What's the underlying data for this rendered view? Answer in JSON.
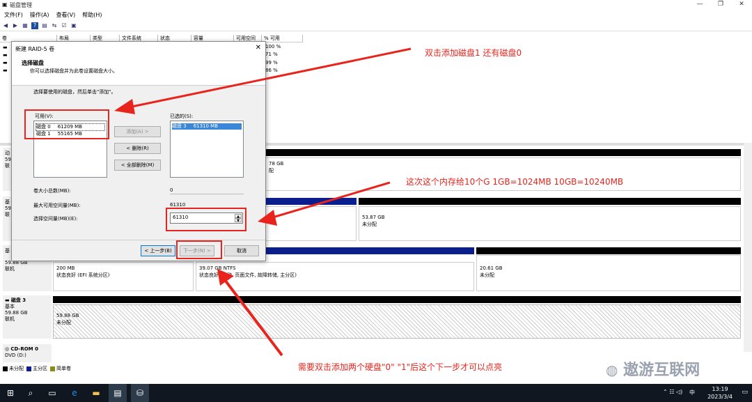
{
  "window": {
    "title": "磁盘管理"
  },
  "menu": [
    "文件(F)",
    "操作(A)",
    "查看(V)",
    "帮助(H)"
  ],
  "volume_list": {
    "headers": [
      "卷",
      "布局",
      "类型",
      "文件系统",
      "状态",
      "容量",
      "可用空间",
      "% 可用"
    ],
    "percent_free": [
      "100 %",
      "71 %",
      "99 %",
      "86 %"
    ]
  },
  "disks": [
    {
      "label": "磁盘 3",
      "type": "基本",
      "size": "59.88 GB",
      "status": "联机",
      "parts": [
        {
          "size": "59.88 GB",
          "desc": "未分配"
        }
      ]
    },
    {
      "label": "CD-ROM 0",
      "type": "DVD (D:)"
    }
  ],
  "disk_partial": {
    "row1": {
      "prefix": [
        "动",
        "59",
        "联"
      ],
      "part_size": "78 GB",
      "part_desc": "配"
    },
    "row2": {
      "prefix": [
        "基",
        "59",
        "联"
      ],
      "right_size": "53.87 GB",
      "right_desc": "未分配"
    },
    "row3": {
      "prefix": [
        "基"
      ],
      "size": "59.88 GB",
      "status": "联机",
      "p1_size": "200 MB",
      "p1_desc": "状态良好 (EFI 系统分区)",
      "p2_size": "39.07 GB NTFS",
      "p2_desc": "状态良好 (启动, 页面文件, 故障转储, 主分区)",
      "p3_size": "20.61 GB",
      "p3_desc": "未分配"
    }
  },
  "legend": [
    "未分配",
    "主分区",
    "简单卷"
  ],
  "legend_colors": [
    "#000000",
    "#0b1e8e",
    "#8a8a18"
  ],
  "dialog": {
    "title": "新建 RAID-5 卷",
    "heading": "选择磁盘",
    "subheading": "你可以选择磁盘并为此卷设置磁盘大小。",
    "instruction": "选择要使用的磁盘，然后单击\"添加\"。",
    "available_label": "可用(V):",
    "available": [
      {
        "disk": "磁盘 0",
        "size": "61209 MB"
      },
      {
        "disk": "磁盘 1",
        "size": "55165 MB"
      }
    ],
    "selected_label": "已选的(S):",
    "selected": [
      {
        "disk": "磁盘 3",
        "size": "61310 MB"
      }
    ],
    "add_button": "添加(A) >",
    "remove_button": "< 删除(R)",
    "remove_all_button": "< 全部删除(M)",
    "total_label": "卷大小总数(MB):",
    "total_value": "0",
    "max_label": "最大可用空间量(MB):",
    "max_value": "61310",
    "select_label": "选择空间量(MB)(E):",
    "select_value": "61310",
    "back_button": "< 上一步(B)",
    "next_button": "下一步(N) >",
    "cancel_button": "取消"
  },
  "annotations": {
    "a1": "双击添加磁盘1 还有磁盘0",
    "a2": "这次这个内存给10个G  1GB=1024MB 10GB=10240MB",
    "a3": "需要双击添加两个硬盘\"0\"  \"1\"后这个下一步才可以点亮"
  },
  "watermark": "遨游互联网",
  "taskbar": {
    "time": "13:19",
    "date": "2023/3/4",
    "ime": "中"
  },
  "accent": "#e8241c"
}
